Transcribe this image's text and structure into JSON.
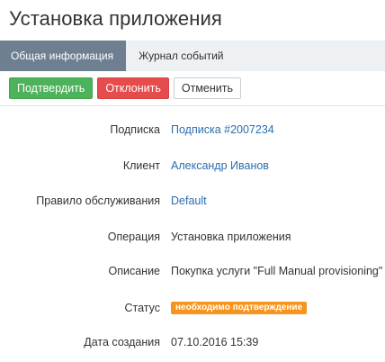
{
  "page": {
    "title": "Установка приложения"
  },
  "tabs": [
    {
      "label": "Общая информация",
      "active": true
    },
    {
      "label": "Журнал событий",
      "active": false
    }
  ],
  "toolbar": {
    "approve_label": "Подтвердить",
    "reject_label": "Отклонить",
    "cancel_label": "Отменить"
  },
  "details": {
    "subscription": {
      "label": "Подписка",
      "value": "Подписка #2007234"
    },
    "client": {
      "label": "Клиент",
      "value": "Александр Иванов"
    },
    "service_rule": {
      "label": "Правило обслуживания",
      "value": "Default"
    },
    "operation": {
      "label": "Операция",
      "value": "Установка приложения"
    },
    "description": {
      "label": "Описание",
      "value": "Покупка услуги \"Full Manual provisioning\""
    },
    "status": {
      "label": "Статус",
      "value": "необходимо подтверждение"
    },
    "created": {
      "label": "Дата создания",
      "value": "07.10.2016 15:39"
    }
  },
  "colors": {
    "tab_active_bg": "#6e7f91",
    "approve": "#4db35a",
    "reject": "#e74c4c",
    "link": "#2a6db0",
    "status_badge": "#f7941d"
  }
}
